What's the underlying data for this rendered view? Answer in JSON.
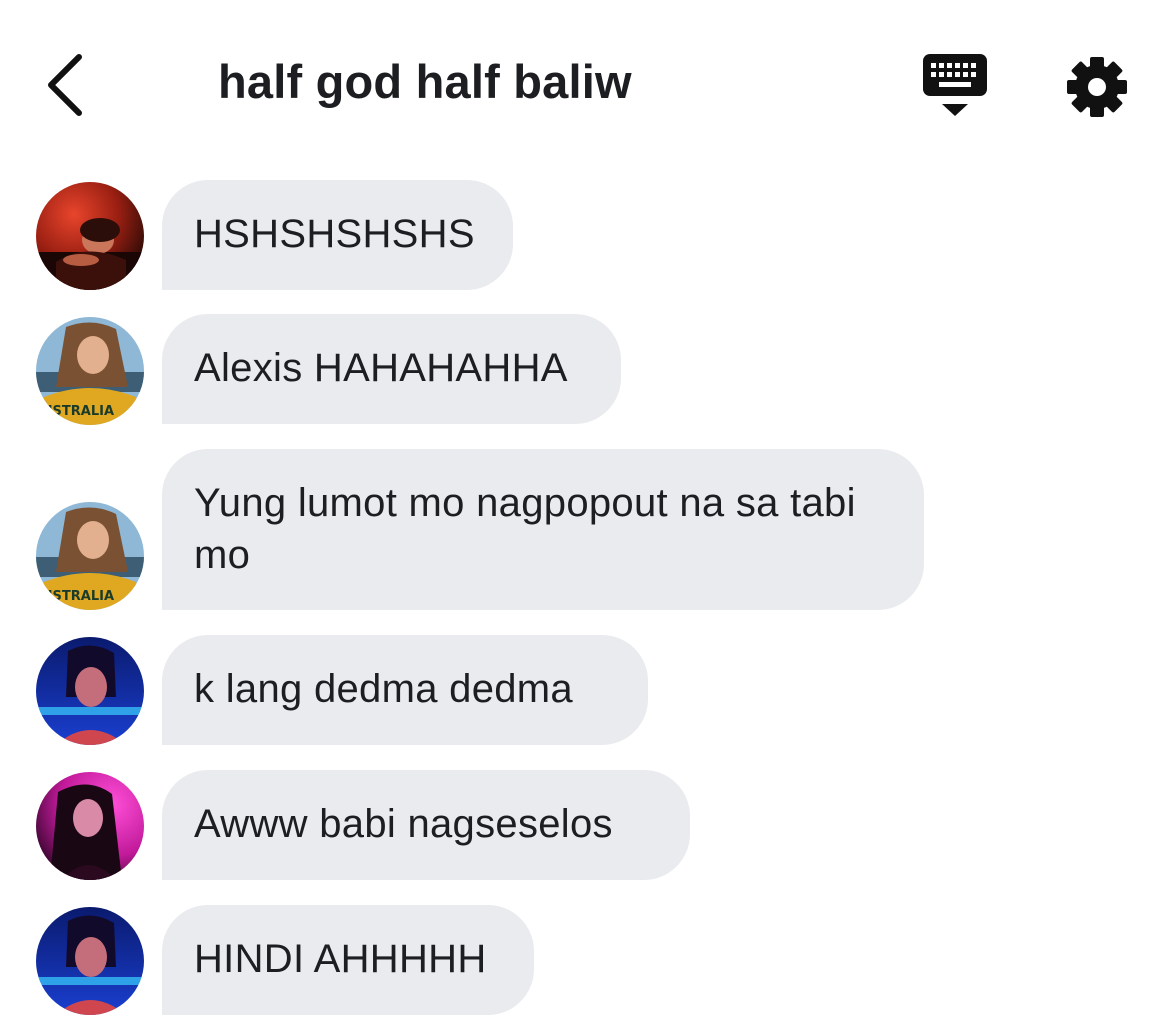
{
  "header": {
    "title": "half god half baliw",
    "back_icon": "chevron-left-icon",
    "keyboard_icon": "keyboard-icon",
    "settings_icon": "gear-icon"
  },
  "messages": [
    {
      "text": "HSHSHSHSHS",
      "avatar": "avatar-red-room"
    },
    {
      "text": "Alexis HAHAHAHHA",
      "avatar": "avatar-australia-shirt",
      "avatar_caption": "USTRALIA"
    },
    {
      "text": "Yung lumot mo nagpopout na sa tabi mo",
      "avatar": "avatar-australia-shirt",
      "avatar_caption": "USTRALIA"
    },
    {
      "text": "k lang dedma dedma",
      "avatar": "avatar-blue-pool"
    },
    {
      "text": "Awww babi nagseselos",
      "avatar": "avatar-pink-neon"
    },
    {
      "text": "HINDI AHHHHH",
      "avatar": "avatar-blue-pool"
    }
  ],
  "colors": {
    "bubble": "#e9ebef",
    "text": "#1c1e21",
    "background": "#ffffff"
  }
}
